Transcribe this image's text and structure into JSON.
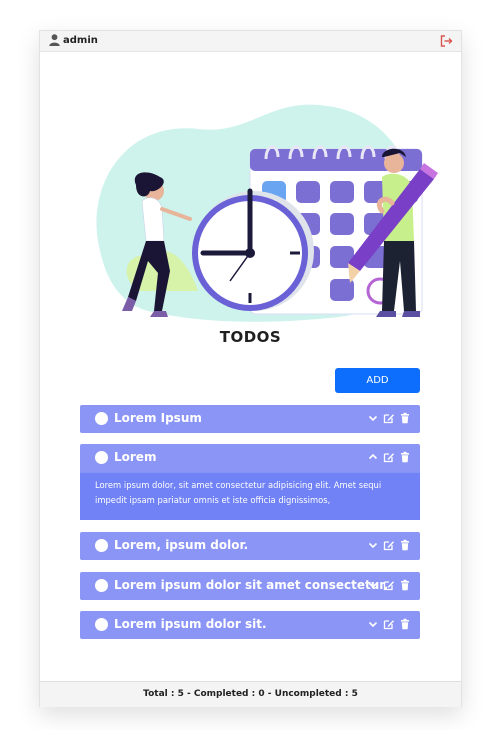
{
  "header": {
    "username": "admin",
    "user_icon": "user-icon",
    "logout_icon": "logout-icon",
    "logout_color": "#d9534f"
  },
  "main": {
    "title": "TODOS",
    "add_label": "ADD",
    "add_color": "#0d6efd"
  },
  "todos": [
    {
      "title": "Lorem Ipsum",
      "completed": false,
      "expanded": false
    },
    {
      "title": "Lorem",
      "completed": false,
      "expanded": true,
      "description": "Lorem ipsum dolor, sit amet consectetur adipisicing elit. Amet sequi impedit ipsam pariatur omnis et iste officia dignissimos,"
    },
    {
      "title": "Lorem, ipsum dolor.",
      "completed": false,
      "expanded": false
    },
    {
      "title": "Lorem ipsum dolor sit amet consectetur.",
      "completed": false,
      "expanded": false
    },
    {
      "title": "Lorem ipsum dolor sit.",
      "completed": false,
      "expanded": false
    }
  ],
  "item_icons": [
    "chevron-down-icon",
    "chevron-up-icon",
    "edit-icon",
    "trash-icon"
  ],
  "colors": {
    "item_bg": "#8b95f6",
    "expanded_body_bg": "#7082f5"
  },
  "footer": {
    "summary": "Total : 5 - Completed : 0 - Uncompleted : 5"
  }
}
